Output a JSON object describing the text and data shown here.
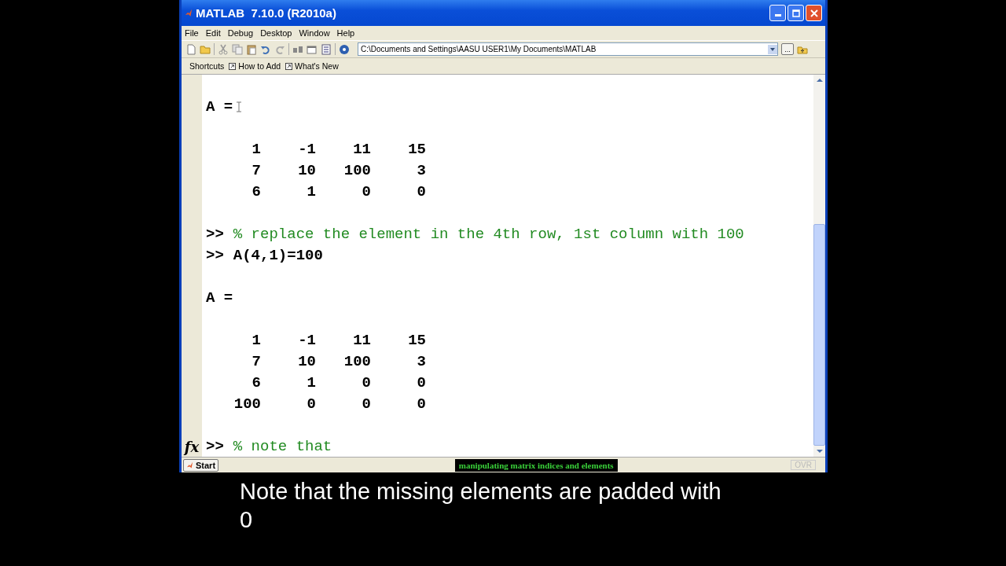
{
  "window": {
    "title": "MATLAB  7.10.0 (R2010a)"
  },
  "menu": [
    "File",
    "Edit",
    "Debug",
    "Desktop",
    "Window",
    "Help"
  ],
  "toolbar": {
    "current_folder": "C:\\Documents and Settings\\AASU USER1\\My Documents\\MATLAB",
    "browse": "..."
  },
  "shortcuts": [
    {
      "kind": "label",
      "text": "Shortcuts"
    },
    {
      "kind": "link",
      "text": "How to Add"
    },
    {
      "kind": "link",
      "text": "What's New"
    }
  ],
  "console": {
    "prompt_icon": "fx",
    "lines": [
      {
        "kind": "blank"
      },
      {
        "kind": "output",
        "text": "A ="
      },
      {
        "kind": "blank"
      },
      {
        "kind": "matrix",
        "cells": [
          "1",
          "-1",
          "11",
          "15"
        ]
      },
      {
        "kind": "matrix",
        "cells": [
          "7",
          "10",
          "100",
          "3"
        ]
      },
      {
        "kind": "matrix",
        "cells": [
          "6",
          "1",
          "0",
          "0"
        ]
      },
      {
        "kind": "blank"
      },
      {
        "kind": "comment",
        "prompt": ">>",
        "text": "% replace the element in the 4th row, 1st column with 100"
      },
      {
        "kind": "command",
        "prompt": ">>",
        "text": "A(4,1)=100"
      },
      {
        "kind": "blank"
      },
      {
        "kind": "output",
        "text": "A ="
      },
      {
        "kind": "blank"
      },
      {
        "kind": "matrix",
        "cells": [
          "1",
          "-1",
          "11",
          "15"
        ]
      },
      {
        "kind": "matrix",
        "cells": [
          "7",
          "10",
          "100",
          "3"
        ]
      },
      {
        "kind": "matrix",
        "cells": [
          "6",
          "1",
          "0",
          "0"
        ]
      },
      {
        "kind": "matrix",
        "cells": [
          "100",
          "0",
          "0",
          "0"
        ]
      },
      {
        "kind": "blank"
      },
      {
        "kind": "comment",
        "prompt": ">>",
        "text": "% note that"
      }
    ]
  },
  "taskbar": {
    "start": "Start",
    "caption": "manipulating matrix indices and elements",
    "indicator": "OVR"
  },
  "subtitle": [
    "Note that the missing elements are padded with",
    "0"
  ]
}
